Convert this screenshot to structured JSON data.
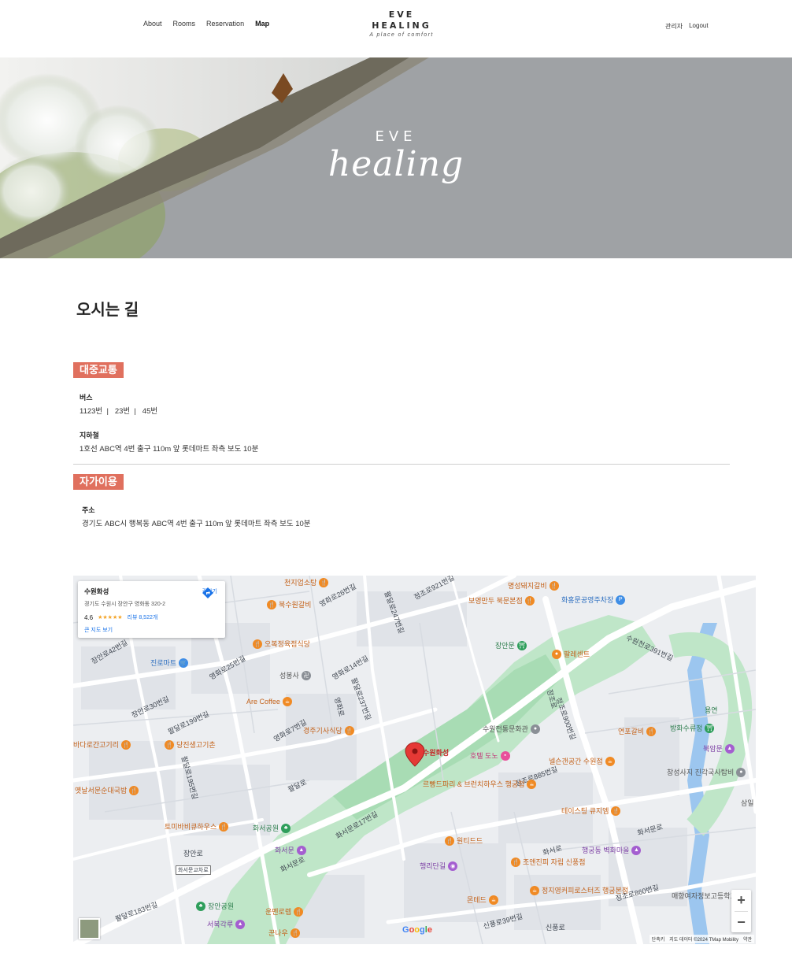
{
  "header": {
    "nav": [
      {
        "label": "About",
        "active": false
      },
      {
        "label": "Rooms",
        "active": false
      },
      {
        "label": "Reservation",
        "active": false
      },
      {
        "label": "Map",
        "active": true
      }
    ],
    "logo_line1": "EVE",
    "logo_line2": "HEALING",
    "logo_tagline": "A place of comfort",
    "admin_label": "관리자",
    "logout_label": "Logout"
  },
  "hero": {
    "eve": "EVE",
    "healing": "healing"
  },
  "content": {
    "page_title": "오시는 길",
    "public_transport": {
      "badge": "대중교통",
      "bus_label": "버스",
      "bus_text": "1123번  |   23번  |   45번",
      "subway_label": "지하철",
      "subway_text": "1호선 ABC역 4번 출구 110m 앞 롯데마트 좌측 보도 10분"
    },
    "car": {
      "badge": "자가이용",
      "address_label": "주소",
      "address_text": "경기도 ABC시 행복동 ABC역 4번 출구 110m 앞 롯데마트 좌측 보도 10분"
    }
  },
  "map": {
    "place_card": {
      "name": "수원화성",
      "address": "경기도 수원시 장안구 영화동 320-2",
      "rating": "4.6",
      "stars": "★★★★★",
      "reviews": "리뷰 8,522개",
      "big_map_link": "큰 지도 보기",
      "directions_label": "길찾기"
    },
    "marker_label": "수원화성",
    "zoom_in": "+",
    "zoom_out": "−",
    "attribution": [
      "단축키",
      "지도 데이터 ©2024 TMap Mobility",
      "약관"
    ],
    "google": [
      "G",
      "o",
      "o",
      "g",
      "l",
      "e"
    ],
    "road_labels": [
      "천지업소탕",
      "북수원갈비",
      "영화로26번길",
      "팔달로247번길",
      "정조로921번길",
      "명성돼지갈비",
      "보영만두 북문본점",
      "화홍문공영주차장",
      "장안로42번길",
      "오복정육점식당",
      "영화로25번길",
      "영화로14번길",
      "성봉사",
      "장안문",
      "수원천로391번길",
      "팔레센트",
      "진로마트",
      "장안로30번길",
      "팔달로199번길",
      "팔달로237번길",
      "Are Coffee",
      "정조로",
      "정조로900번길",
      "연포갈비",
      "방화수류정",
      "용연",
      "바다로간고기리",
      "당진생고기촌",
      "영화로",
      "영화로7번길",
      "경주기사식당",
      "수원화성",
      "수원전통문화관",
      "호텔 도노",
      "넬슨갠공간 수원점",
      "정조로885번길",
      "북암문",
      "팔달로195번길",
      "옛날서문순대국밥",
      "팔달로",
      "르빵드파리 & 브런치하우스 행궁점",
      "테이스팅 큐지엠",
      "창성사지 진각국사탑비",
      "삼일",
      "토미바비큐하우스",
      "화서공원",
      "화서문로17번길",
      "원티드드",
      "화서문로",
      "화서문",
      "장안로",
      "화서문교차로",
      "화서문로",
      "행궁동 벽화마을",
      "행리단길",
      "조앤진피 자립 신풍점",
      "화서로",
      "팔달로183번길",
      "몬테드",
      "정지영커피로스터즈 행궁본점",
      "정조로860번길",
      "매향여자정보고등학교",
      "서북각루",
      "운멘로렙",
      "꾼나우",
      "신풍로39번길",
      "신풍로",
      "장안공원"
    ]
  }
}
